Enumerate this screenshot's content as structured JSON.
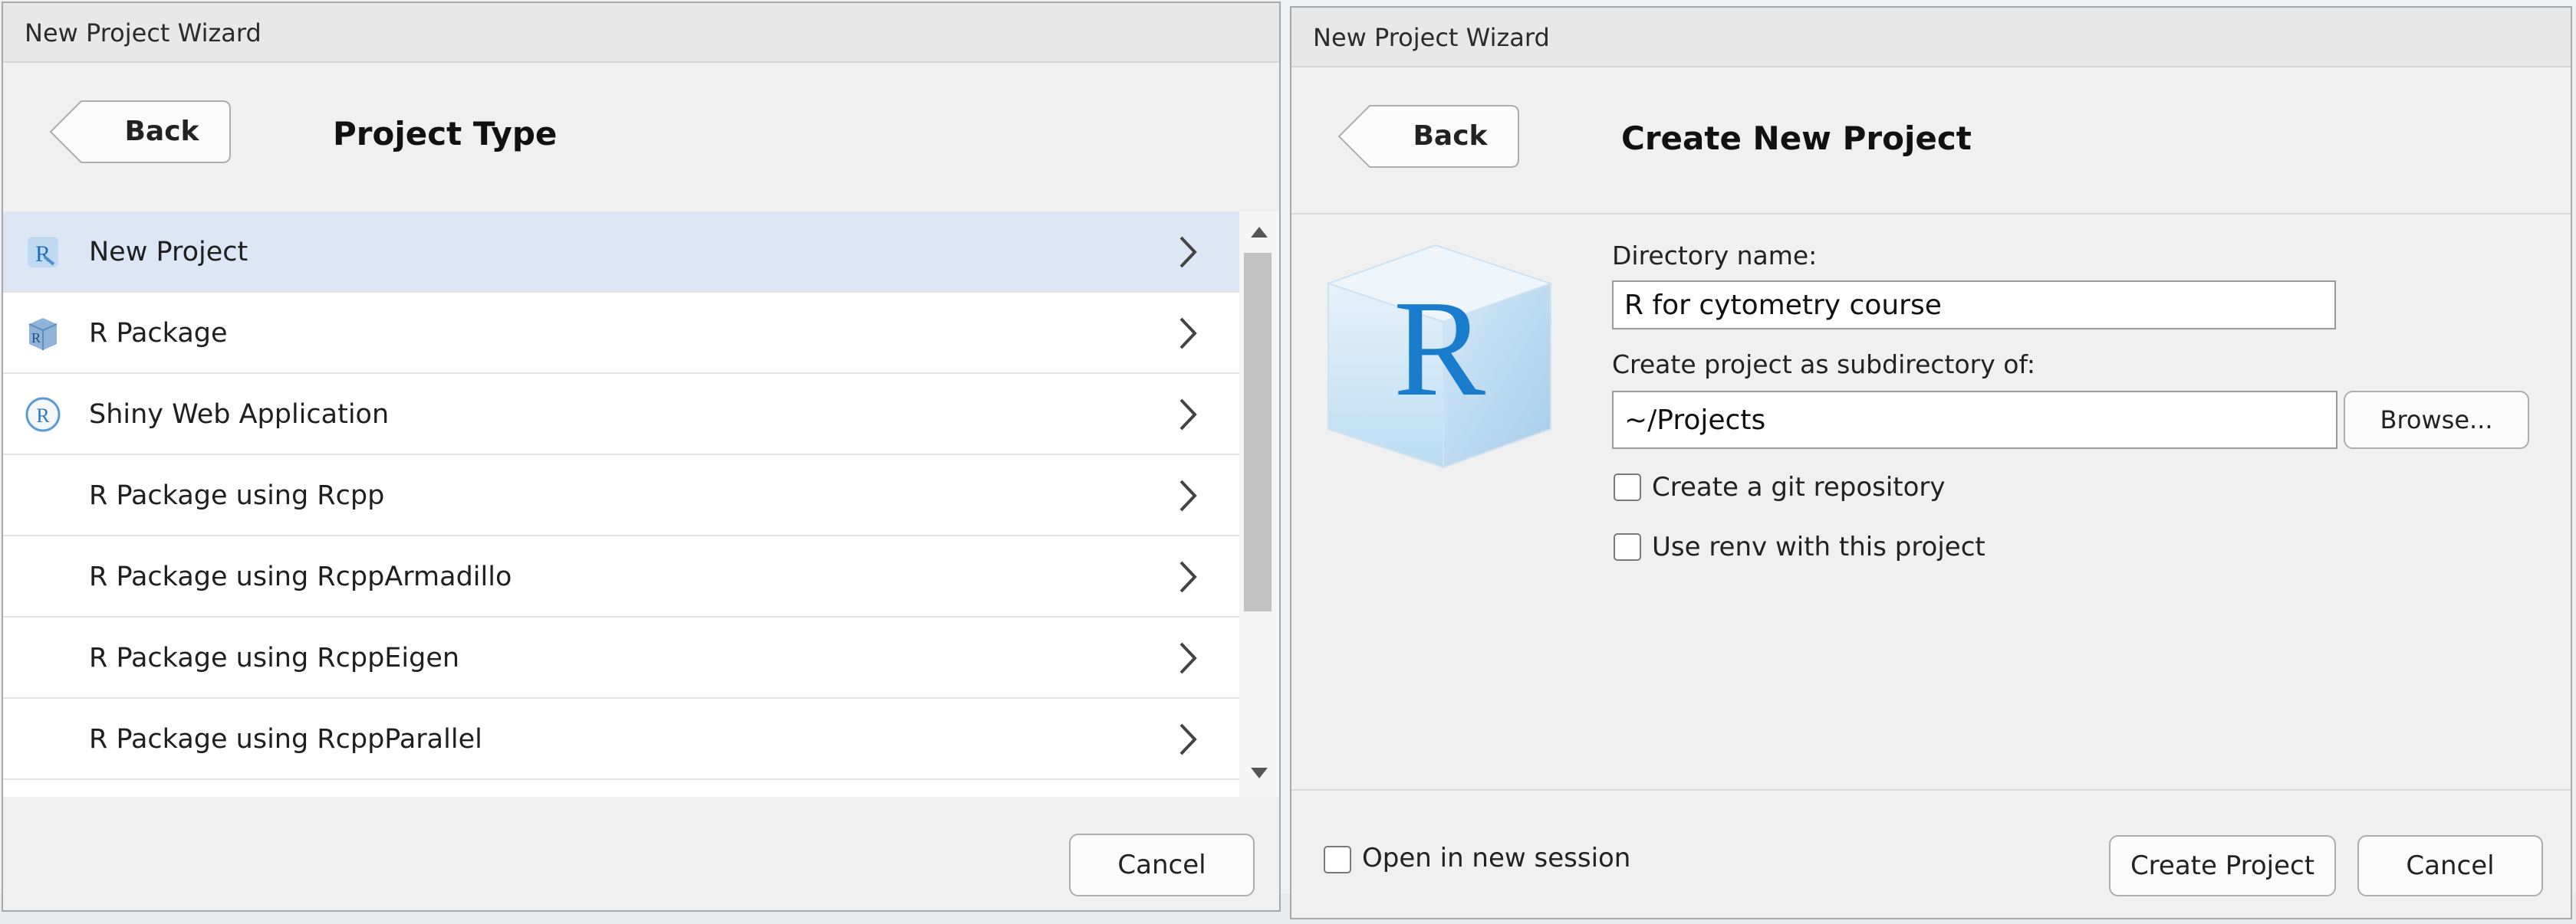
{
  "left_window": {
    "title": "New Project Wizard",
    "back_label": "Back",
    "heading": "Project Type",
    "items": [
      {
        "label": "New Project",
        "icon": "r-project-icon",
        "selected": true
      },
      {
        "label": "R Package",
        "icon": "r-package-icon",
        "selected": false
      },
      {
        "label": "Shiny Web Application",
        "icon": "shiny-icon",
        "selected": false
      },
      {
        "label": "R Package using Rcpp",
        "icon": "",
        "selected": false
      },
      {
        "label": "R Package using RcppArmadillo",
        "icon": "",
        "selected": false
      },
      {
        "label": "R Package using RcppEigen",
        "icon": "",
        "selected": false
      },
      {
        "label": "R Package using RcppParallel",
        "icon": "",
        "selected": false
      }
    ],
    "cancel_label": "Cancel"
  },
  "right_window": {
    "title": "New Project Wizard",
    "back_label": "Back",
    "heading": "Create New Project",
    "directory_label": "Directory name:",
    "directory_value": "R for cytometry course",
    "subdir_label": "Create project as subdirectory of:",
    "subdir_value": "~/Projects",
    "browse_label": "Browse...",
    "git_label": "Create a git repository",
    "renv_label": "Use renv with this project",
    "open_session_label": "Open in new session",
    "create_label": "Create Project",
    "cancel_label": "Cancel",
    "logo_text": "R"
  },
  "colors": {
    "selected_row": "#dce6f4",
    "r_blue": "#1a7ccc",
    "window_bg": "#f0f0f0"
  }
}
